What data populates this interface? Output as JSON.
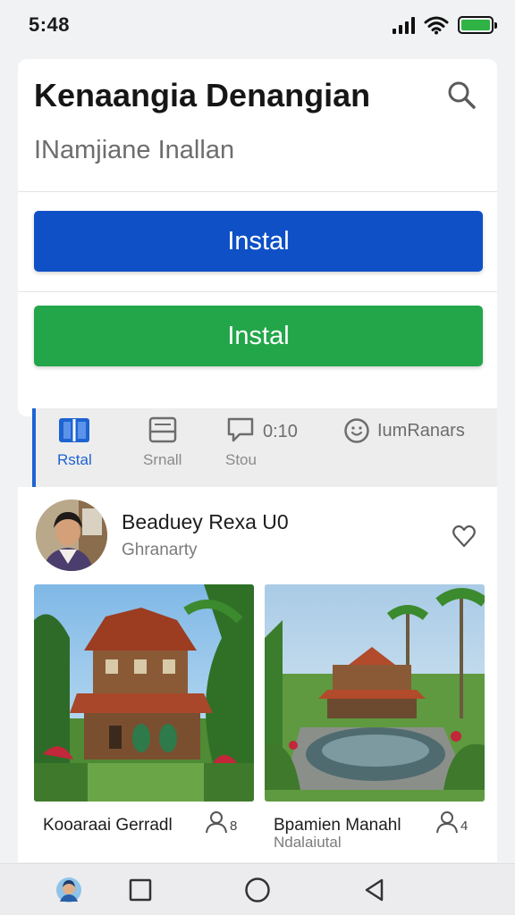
{
  "status": {
    "time": "5:48",
    "battery_color": "#2fb344"
  },
  "header": {
    "title": "Kenaangia Denangian",
    "subtitle": "INamjiane Inallan",
    "search_icon": "search-icon"
  },
  "buttons": {
    "primary_label": "Instal",
    "secondary_label": "Instal",
    "primary_color": "#0f50c6",
    "secondary_color": "#23a64a"
  },
  "tabs": [
    {
      "label": "Rstal",
      "icon": "book-icon",
      "active": true
    },
    {
      "label": "Srnall",
      "icon": "tray-icon",
      "active": false
    },
    {
      "label": "Stou",
      "icon": "chat-icon",
      "active": false,
      "inline": "0:10"
    },
    {
      "label": "",
      "icon": "smiley-icon",
      "active": false,
      "inline": "IumRanars"
    }
  ],
  "profile": {
    "name": "Beaduey Rexa U0",
    "role": "Ghranarty"
  },
  "posts": [
    {
      "title": "Kooaraai Gerradl",
      "subtitle": "",
      "count": "8"
    },
    {
      "title": "Bpamien Manahl",
      "subtitle": "Ndalaiutal",
      "count": "4"
    }
  ],
  "nav": [
    "home-avatar-icon",
    "recents-square-icon",
    "home-circle-icon",
    "back-triangle-icon"
  ]
}
